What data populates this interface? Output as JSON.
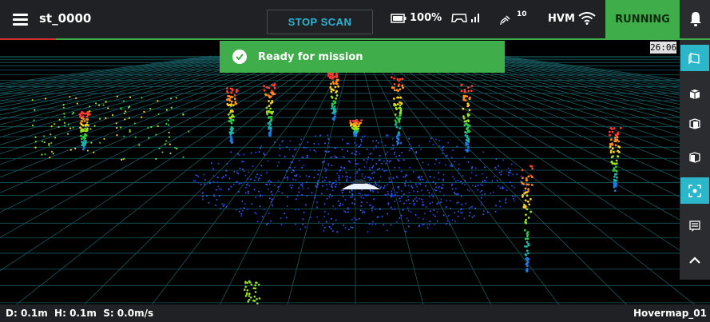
{
  "header": {
    "title": "st_0000",
    "stop_label": "STOP SCAN",
    "battery": "100%",
    "device_label": "HVM",
    "satellites": "10",
    "status": "RUNNING",
    "colors": {
      "accent": "#29b6d6",
      "running": "#3fae4a",
      "alert_line": "#d32f2f",
      "bar_bg": "#1f2124"
    }
  },
  "toast": {
    "message": "Ready for mission"
  },
  "timer": "26:06",
  "sidebar": {
    "buttons": [
      {
        "icon": "perspective-view-icon",
        "active": true
      },
      {
        "icon": "cube-view-icon",
        "active": false
      },
      {
        "icon": "front-view-icon",
        "active": false
      },
      {
        "icon": "side-view-icon",
        "active": false
      },
      {
        "icon": "center-focus-icon",
        "active": true
      },
      {
        "icon": "message-icon",
        "active": false
      },
      {
        "icon": "chevron-up-icon",
        "active": false
      }
    ]
  },
  "footer": {
    "stats": "D: 0.1m  H: 0.1m  S: 0.0m/s",
    "device": "Hovermap_01"
  }
}
